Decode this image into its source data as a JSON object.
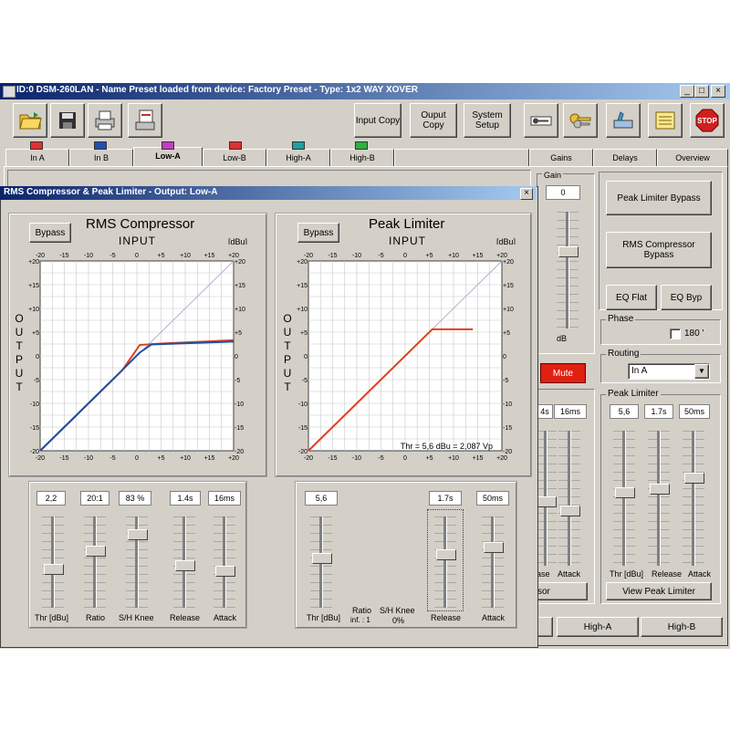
{
  "window": {
    "title": "ID:0 DSM-260LAN - Name Preset loaded from device: Factory Preset - Type: 1x2 WAY XOVER",
    "min": "_",
    "max": "□",
    "close": "×"
  },
  "toolbar": {
    "input_copy": "Input Copy",
    "output_copy": "Ouput Copy",
    "system_setup": "System Setup"
  },
  "tabs": [
    {
      "label": "In A",
      "color": "#e03030"
    },
    {
      "label": "In B",
      "color": "#2050b0"
    },
    {
      "label": "Low-A",
      "color": "#c040c0"
    },
    {
      "label": "Low-B",
      "color": "#e03030"
    },
    {
      "label": "High-A",
      "color": "#20a0a0"
    },
    {
      "label": "High-B",
      "color": "#30b040"
    },
    {
      "label": "Gains"
    },
    {
      "label": "Delays"
    },
    {
      "label": "Overview"
    }
  ],
  "right": {
    "gain_label": "Gain",
    "gain_value": "0",
    "db_label": "dB",
    "mute_label": "Mute",
    "peak_limiter_bypass": "Peak Limiter Bypass",
    "rms_compressor_bypass": "RMS Compressor Bypass",
    "eq_flat": "EQ Flat",
    "eq_byp": "EQ Byp",
    "phase_label": "Phase",
    "phase_180": "180 '",
    "routing_label": "Routing",
    "routing_value": "In A",
    "peak_limiter_label": "Peak Limiter",
    "pl_thr": "5,6",
    "pl_release": "1.7s",
    "pl_attack": "50ms",
    "pl_lbl_thr": "Thr [dBu]",
    "pl_lbl_release": "Release",
    "pl_lbl_attack": "Attack",
    "view_peak_limiter": "View Peak Limiter",
    "mid_release": "4s",
    "mid_attack": "16ms",
    "mid_lbl_release": "ase",
    "mid_lbl_attack": "Attack",
    "mid_btn": "sor",
    "bottom_tab_high_a": "High-A",
    "bottom_tab_high_b": "High-B"
  },
  "dialog": {
    "title": "RMS Compressor & Peak Limiter - Output:  Low-A",
    "close": "×",
    "bypass": "Bypass",
    "input_label": "INPUT",
    "output_label": "OUTPUT",
    "unit": "[dBu]",
    "rms": {
      "title": "RMS Compressor",
      "values": {
        "thr": "2,2",
        "ratio": "20:1",
        "knee": "83 %",
        "release": "1.4s",
        "attack": "16ms"
      },
      "labels": {
        "thr": "Thr [dBu]",
        "ratio": "Ratio",
        "knee": "S/H Knee",
        "release": "Release",
        "attack": "Attack"
      }
    },
    "peak": {
      "title": "Peak Limiter",
      "annotation": "Thr = 5,6 dBu = 2,087 Vp",
      "values": {
        "thr": "5,6",
        "release": "1.7s",
        "attack": "50ms"
      },
      "labels": {
        "thr": "Thr [dBu]",
        "ratio": "Ratio",
        "ratio_sub": "inf. : 1",
        "knee": "S/H Knee",
        "knee_sub": "0%",
        "release": "Release",
        "attack": "Attack"
      }
    }
  },
  "chart_data": [
    {
      "type": "line",
      "title": "RMS Compressor",
      "xlabel": "INPUT",
      "ylabel": "OUTPUT",
      "xlim": [
        -20,
        20
      ],
      "ylim": [
        -20,
        20
      ],
      "x_ticks": [
        "-20",
        "-15",
        "-10",
        "-5",
        "0",
        "+5",
        "+10",
        "+15",
        "+20"
      ],
      "y_ticks": [
        "+20",
        "+15",
        "+10",
        "+5",
        "0",
        "-5",
        "-10",
        "-15",
        "-20"
      ],
      "grid": true,
      "series": [
        {
          "color": "#b0b0d0",
          "x": [
            -20,
            20
          ],
          "y": [
            -20,
            20
          ]
        },
        {
          "color": "#e04020",
          "x": [
            -20,
            -3,
            0.6,
            5,
            20
          ],
          "y": [
            -20,
            -3,
            2.3,
            2.6,
            3.3
          ]
        },
        {
          "color": "#2050a0",
          "x": [
            -20,
            -5,
            0.6,
            3,
            20
          ],
          "y": [
            -20,
            -5,
            0.7,
            2.4,
            3.0
          ]
        }
      ]
    },
    {
      "type": "line",
      "title": "Peak Limiter",
      "xlabel": "INPUT",
      "ylabel": "OUTPUT",
      "xlim": [
        -20,
        20
      ],
      "ylim": [
        -20,
        20
      ],
      "x_ticks": [
        "-20",
        "-15",
        "-10",
        "-5",
        "0",
        "+5",
        "+10",
        "+15",
        "+20"
      ],
      "y_ticks": [
        "+20",
        "+15",
        "+10",
        "+5",
        "0",
        "-5",
        "-10",
        "-15",
        "-20"
      ],
      "grid": true,
      "series": [
        {
          "color": "#b0b0d0",
          "x": [
            -20,
            20
          ],
          "y": [
            -20,
            20
          ]
        },
        {
          "color": "#e04020",
          "x": [
            -20,
            5.6,
            14
          ],
          "y": [
            -20,
            5.6,
            5.6
          ]
        }
      ]
    }
  ]
}
